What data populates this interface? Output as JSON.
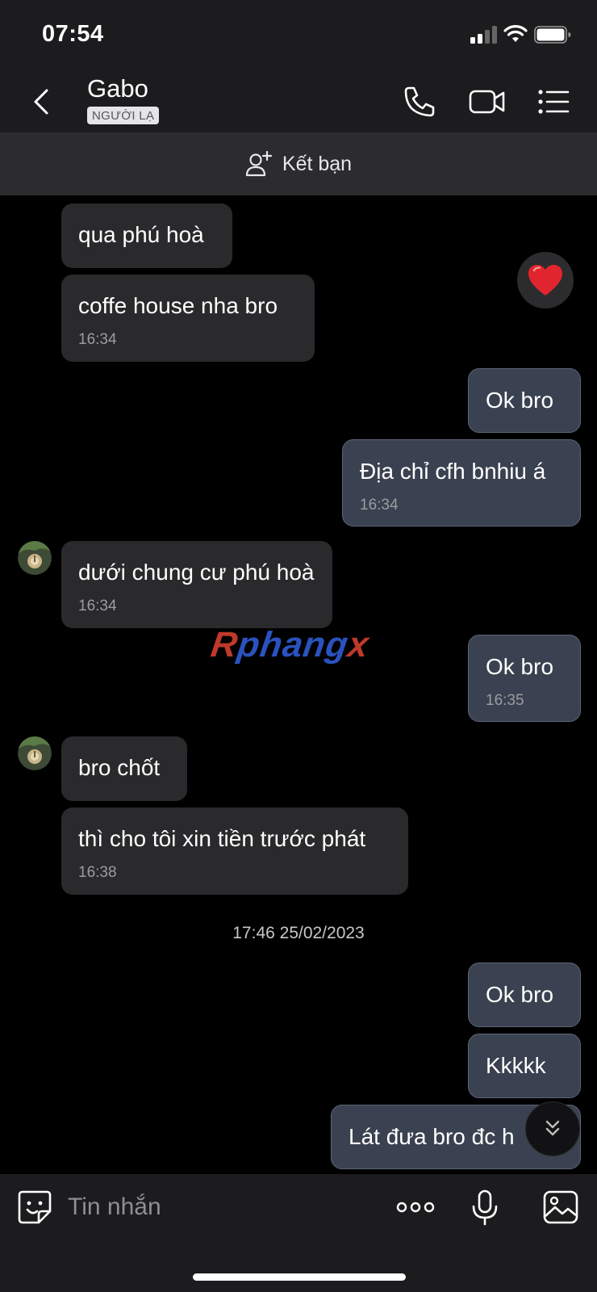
{
  "status_bar": {
    "time": "07:54"
  },
  "header": {
    "contact_name": "Gabo",
    "badge": "NGƯỜI LẠ",
    "icons": [
      "back-chevron-icon",
      "phone-icon",
      "video-camera-icon",
      "list-menu-icon"
    ]
  },
  "add_friend": {
    "label": "Kết bạn",
    "icon": "add-user-icon"
  },
  "messages": [
    {
      "side": "in",
      "text": "qua phú hoà",
      "time": ""
    },
    {
      "side": "in",
      "text": "coffe house nha bro",
      "time": "16:34"
    },
    {
      "side": "out",
      "text": "Ok bro",
      "time": ""
    },
    {
      "side": "out",
      "text": "Địa chỉ cfh bnhiu á",
      "time": "16:34"
    },
    {
      "side": "in",
      "text": "dưới chung cư phú hoà",
      "time": "16:34"
    },
    {
      "side": "out",
      "text": "Ok bro",
      "time": "16:35"
    },
    {
      "side": "in",
      "text": "bro chốt",
      "time": ""
    },
    {
      "side": "in",
      "text": "thì cho tôi xin tiền trước phát",
      "time": "16:38"
    },
    {
      "side": "out",
      "text": "Ok bro",
      "time": ""
    },
    {
      "side": "out",
      "text": "Kkkkk",
      "time": ""
    },
    {
      "side": "out",
      "text": "Lát đưa bro đc h",
      "time": ""
    }
  ],
  "reaction": {
    "icon": "heart-icon",
    "color": "#e0252f"
  },
  "date_separator": "17:46 25/02/2023",
  "watermark": {
    "r": "R",
    "mid": "phang",
    "x": "x"
  },
  "composer": {
    "placeholder": "Tin nhắn",
    "icons": [
      "sticker-icon",
      "more-options-icon",
      "microphone-icon",
      "image-icon"
    ]
  },
  "colors": {
    "incoming_bubble": "#2a2a2c",
    "outgoing_bubble": "#3a4150",
    "background": "#000000"
  }
}
